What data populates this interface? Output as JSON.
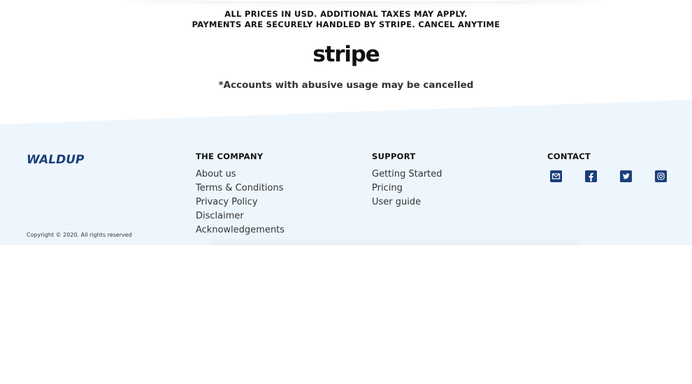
{
  "pricing_notice": {
    "line1": "ALL PRICES IN USD. ADDITIONAL TAXES MAY APPLY.",
    "line2": "PAYMENTS ARE SECURELY HANDLED BY STRIPE. CANCEL ANYTIME"
  },
  "payment_logo": "stripe",
  "abuse_notice": "*Accounts with abusive usage may be cancelled",
  "footer": {
    "background_color": "#eef6fd",
    "brand_logo": "WALDUP",
    "copyright": "Copyright © 2020. All rights reserved",
    "company": {
      "title": "THE COMPANY",
      "links": [
        "About us",
        "Terms & Conditions",
        "Privacy Policy",
        "Disclaimer",
        "Acknowledgements"
      ]
    },
    "support": {
      "title": "SUPPORT",
      "links": [
        "Getting Started",
        "Pricing",
        "User guide"
      ]
    },
    "contact": {
      "title": "CONTACT",
      "icons": [
        "email-icon",
        "facebook-icon",
        "twitter-icon",
        "instagram-icon"
      ],
      "icon_color": "#1c3f7a"
    }
  }
}
